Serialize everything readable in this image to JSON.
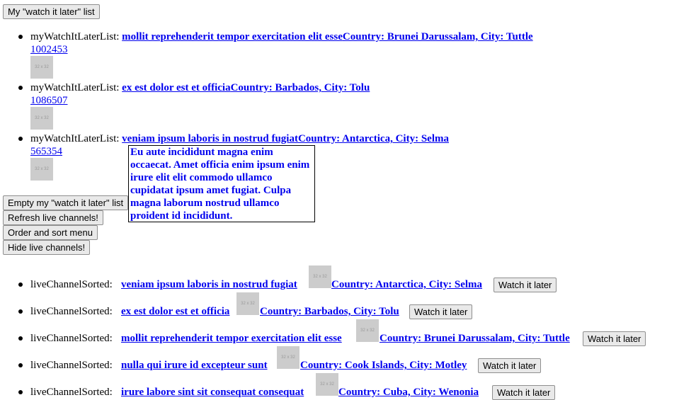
{
  "top_button": "My \"watch it later\" list",
  "watch_list": {
    "prefix": "myWatchItLaterList:",
    "items": [
      {
        "title": "mollit reprehenderit tempor exercitation elit esse",
        "location": "Country: Brunei Darussalam, City: Tuttle",
        "id": "1002453",
        "thumb": "32 x 32"
      },
      {
        "title": "ex est dolor est et officia",
        "location": "Country: Barbados, City: Tolu",
        "id": "1086507",
        "thumb": "32 x 32"
      },
      {
        "title": "veniam ipsum laboris in nostrud fugiat",
        "location": "Country: Antarctica, City: Selma",
        "id": "565354",
        "thumb": "32 x 32"
      }
    ]
  },
  "tooltip": "Eu aute incididunt magna enim occaecat. Amet officia enim ipsum enim irure elit elit commodo ullamco cupidatat ipsum amet fugiat. Culpa magna laborum nostrud ullamco proident id incididunt.",
  "controls": {
    "empty": "Empty my \"watch it later\" list",
    "refresh": "Refresh live channels!",
    "order": "Order and sort menu",
    "hide": "Hide live channels!"
  },
  "live": {
    "prefix": "liveChannelSorted:",
    "watch_label": "Watch it later",
    "items": [
      {
        "title": "veniam ipsum laboris in nostrud fugiat",
        "location": "Country: Antarctica, City: Selma",
        "thumb": "32 x 32"
      },
      {
        "title": "ex est dolor est et officia",
        "location": "Country: Barbados, City: Tolu",
        "thumb": "32 x 32"
      },
      {
        "title": "mollit reprehenderit tempor exercitation elit esse",
        "location": "Country: Brunei Darussalam, City: Tuttle",
        "thumb": "32 x 32"
      },
      {
        "title": "nulla qui irure id excepteur sunt",
        "location": "Country: Cook Islands, City: Motley",
        "thumb": "32 x 32"
      },
      {
        "title": "irure labore sint sit consequat consequat",
        "location": "Country: Cuba, City: Wenonia",
        "thumb": "32 x 32"
      }
    ]
  }
}
